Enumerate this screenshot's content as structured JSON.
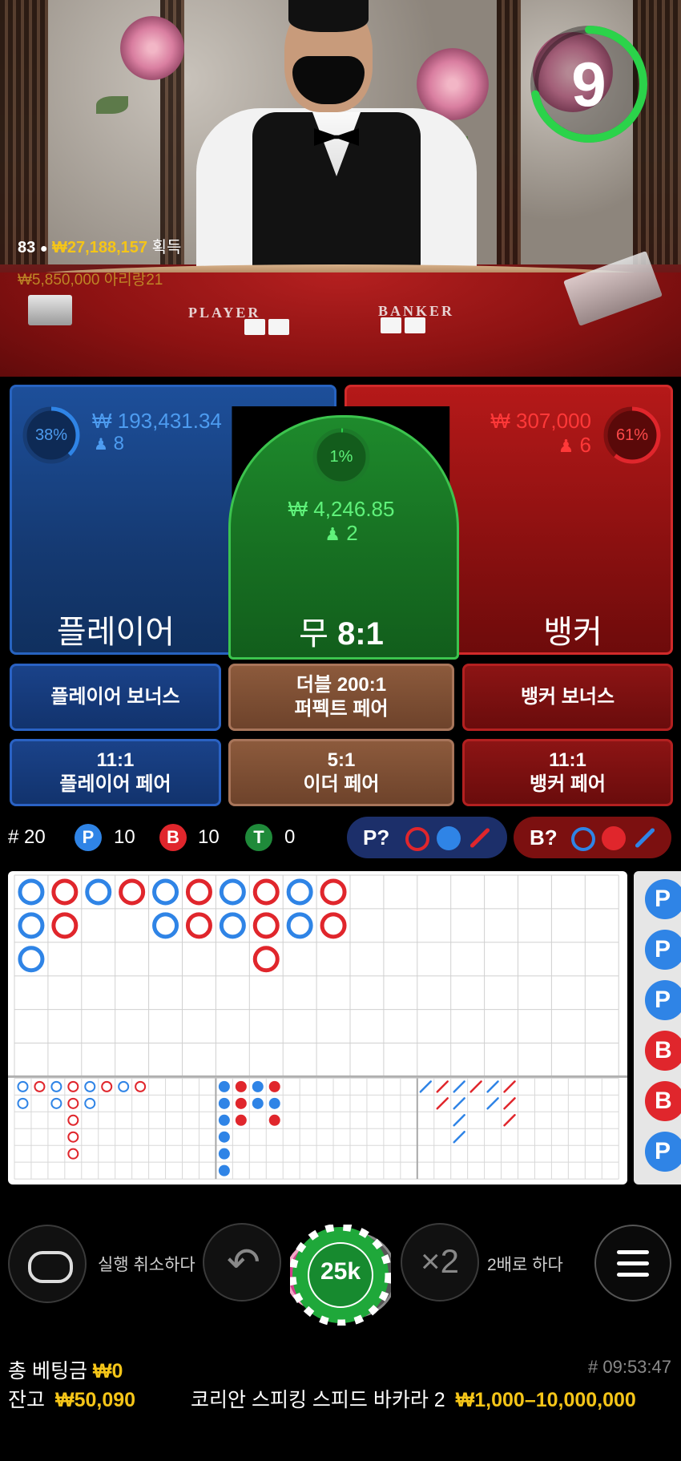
{
  "timer": {
    "value": "9",
    "progress": 0.72
  },
  "winners": {
    "count": "83",
    "amount": "₩27,188,157",
    "label": "획득"
  },
  "last_win": {
    "amount": "₩5,850,000",
    "user": "아리랑21"
  },
  "felt": {
    "player_label": "PLAYER",
    "banker_label": "BANKER"
  },
  "player": {
    "percent": "38%",
    "percent_value": 0.38,
    "amount": "₩ 193,431.34",
    "users": "8",
    "name": "플레이어"
  },
  "tie": {
    "percent": "1%",
    "percent_value": 0.01,
    "amount": "₩ 4,246.85",
    "users": "2",
    "name_prefix": "무",
    "payout": "8:1"
  },
  "banker": {
    "percent": "61%",
    "percent_value": 0.61,
    "amount": "₩ 307,000",
    "users": "6",
    "name": "뱅커"
  },
  "side_bets": {
    "player_bonus": "플레이어 보너스",
    "perfect_pair_line1": "더블 200:1",
    "perfect_pair_line2": "퍼펙트 페어",
    "banker_bonus": "뱅커 보너스",
    "player_pair_line1": "11:1",
    "player_pair_line2": "플레이어 페어",
    "either_pair_line1": "5:1",
    "either_pair_line2": "이더 페어",
    "banker_pair_line1": "11:1",
    "banker_pair_line2": "뱅커 페어"
  },
  "stats": {
    "rounds": "# 20",
    "p_letter": "P",
    "p_count": "10",
    "b_letter": "B",
    "b_count": "10",
    "t_letter": "T",
    "t_count": "0"
  },
  "predict": {
    "player_label": "P?",
    "banker_label": "B?"
  },
  "bead_side": [
    "P",
    "P",
    "P",
    "B",
    "B",
    "P"
  ],
  "big_road": [
    [
      "P",
      "B",
      "P",
      "B",
      "P",
      "B",
      "P",
      "B",
      "P",
      "B"
    ],
    [
      "P",
      "B",
      "",
      "",
      "P",
      "B",
      "P",
      "B",
      "P",
      "B"
    ],
    [
      "P",
      "",
      "",
      "",
      "",
      "",
      "",
      "B",
      "",
      ""
    ]
  ],
  "controls": {
    "undo_label": "실행 취소하다",
    "chip_value": "25k",
    "double_symbol": "×2",
    "double_label": "2배로 하다"
  },
  "footer": {
    "total_bet_label": "총 베팅금",
    "total_bet": "₩0",
    "balance_label": "잔고",
    "balance": "₩50,090",
    "game_id": "# 09:53:47",
    "table_name": "코리안 스피킹 스피드 바카라 2",
    "limits": "₩1,000–10,000,000"
  },
  "colors": {
    "player": "#2f84e6",
    "banker": "#e0262c",
    "tie": "#2bd34a",
    "gold": "#f5c518"
  }
}
